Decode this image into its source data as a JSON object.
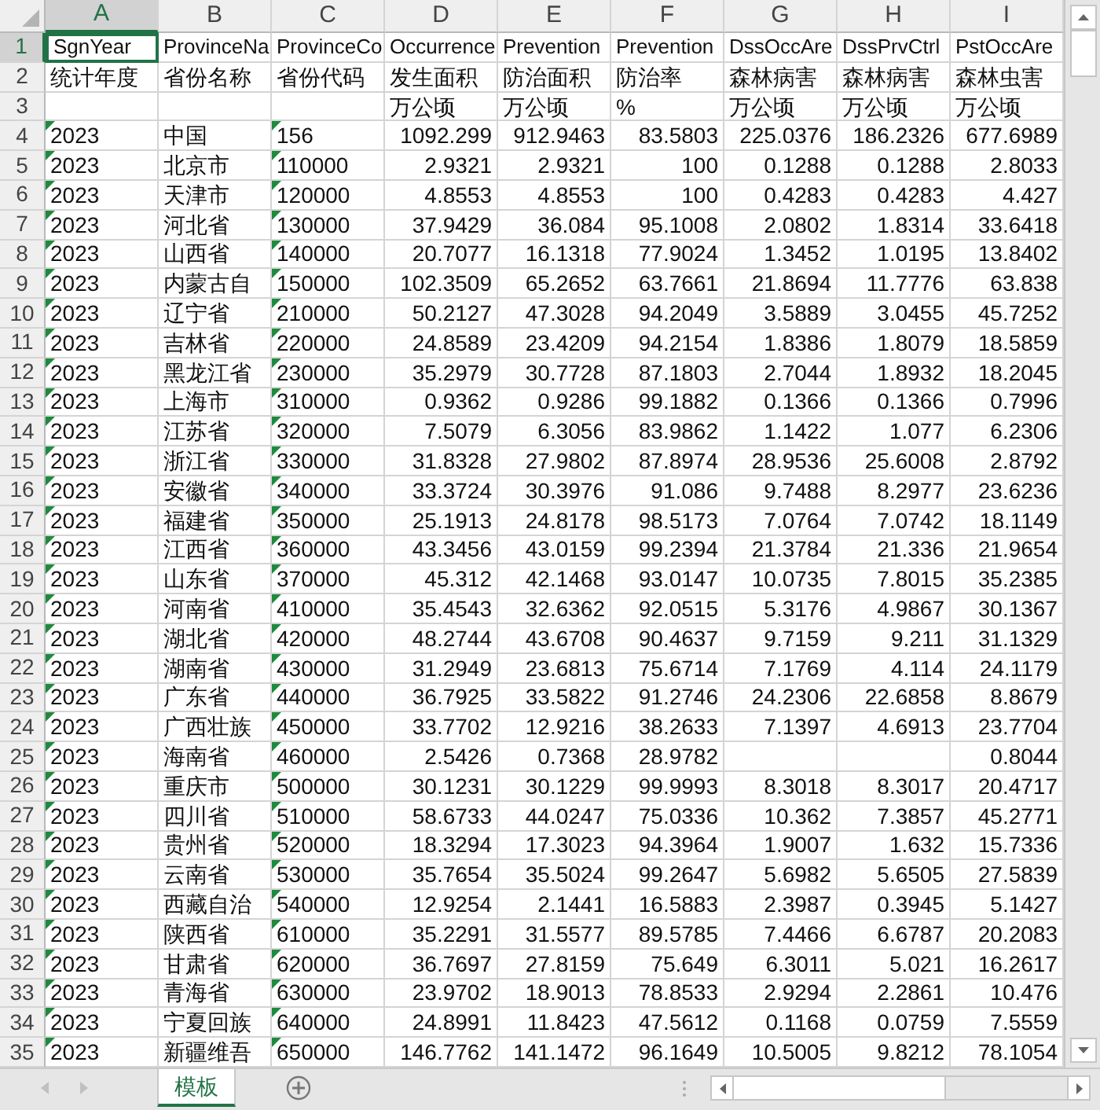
{
  "columns": [
    {
      "letter": "A",
      "selected": true,
      "kind": "text",
      "number_as_text": true
    },
    {
      "letter": "B",
      "selected": false,
      "kind": "text",
      "number_as_text": false
    },
    {
      "letter": "C",
      "selected": false,
      "kind": "text",
      "number_as_text": true
    },
    {
      "letter": "D",
      "selected": false,
      "kind": "number",
      "number_as_text": false
    },
    {
      "letter": "E",
      "selected": false,
      "kind": "number",
      "number_as_text": false
    },
    {
      "letter": "F",
      "selected": false,
      "kind": "number",
      "number_as_text": false
    },
    {
      "letter": "G",
      "selected": false,
      "kind": "number",
      "number_as_text": false
    },
    {
      "letter": "H",
      "selected": false,
      "kind": "number",
      "number_as_text": false
    },
    {
      "letter": "I",
      "selected": false,
      "kind": "number",
      "number_as_text": false
    }
  ],
  "rows": [
    {
      "number": "1",
      "kind": "header",
      "selected": true,
      "cells": [
        "SgnYear",
        "ProvinceNa",
        "ProvinceCo",
        "Occurrence",
        "Prevention",
        "Prevention",
        "DssOccAre",
        "DssPrvCtrl",
        "PstOccAre"
      ]
    },
    {
      "number": "2",
      "kind": "header",
      "selected": false,
      "cells": [
        "统计年度",
        "省份名称",
        "省份代码",
        "发生面积",
        "防治面积",
        "防治率",
        "森林病害",
        "森林病害",
        "森林虫害"
      ]
    },
    {
      "number": "3",
      "kind": "header",
      "selected": false,
      "cells": [
        null,
        null,
        null,
        "万公顷",
        "万公顷",
        "%",
        "万公顷",
        "万公顷",
        "万公顷"
      ]
    },
    {
      "number": "4",
      "kind": "data",
      "selected": false,
      "cells": [
        "2023",
        "中国",
        "156",
        "1092.299",
        "912.9463",
        "83.5803",
        "225.0376",
        "186.2326",
        "677.6989"
      ]
    },
    {
      "number": "5",
      "kind": "data",
      "selected": false,
      "cells": [
        "2023",
        "北京市",
        "110000",
        "2.9321",
        "2.9321",
        "100",
        "0.1288",
        "0.1288",
        "2.8033"
      ]
    },
    {
      "number": "6",
      "kind": "data",
      "selected": false,
      "cells": [
        "2023",
        "天津市",
        "120000",
        "4.8553",
        "4.8553",
        "100",
        "0.4283",
        "0.4283",
        "4.427"
      ]
    },
    {
      "number": "7",
      "kind": "data",
      "selected": false,
      "cells": [
        "2023",
        "河北省",
        "130000",
        "37.9429",
        "36.084",
        "95.1008",
        "2.0802",
        "1.8314",
        "33.6418"
      ]
    },
    {
      "number": "8",
      "kind": "data",
      "selected": false,
      "cells": [
        "2023",
        "山西省",
        "140000",
        "20.7077",
        "16.1318",
        "77.9024",
        "1.3452",
        "1.0195",
        "13.8402"
      ]
    },
    {
      "number": "9",
      "kind": "data",
      "selected": false,
      "cells": [
        "2023",
        "内蒙古自",
        "150000",
        "102.3509",
        "65.2652",
        "63.7661",
        "21.8694",
        "11.7776",
        "63.838"
      ]
    },
    {
      "number": "10",
      "kind": "data",
      "selected": false,
      "cells": [
        "2023",
        "辽宁省",
        "210000",
        "50.2127",
        "47.3028",
        "94.2049",
        "3.5889",
        "3.0455",
        "45.7252"
      ]
    },
    {
      "number": "11",
      "kind": "data",
      "selected": false,
      "cells": [
        "2023",
        "吉林省",
        "220000",
        "24.8589",
        "23.4209",
        "94.2154",
        "1.8386",
        "1.8079",
        "18.5859"
      ]
    },
    {
      "number": "12",
      "kind": "data",
      "selected": false,
      "cells": [
        "2023",
        "黑龙江省",
        "230000",
        "35.2979",
        "30.7728",
        "87.1803",
        "2.7044",
        "1.8932",
        "18.2045"
      ]
    },
    {
      "number": "13",
      "kind": "data",
      "selected": false,
      "cells": [
        "2023",
        "上海市",
        "310000",
        "0.9362",
        "0.9286",
        "99.1882",
        "0.1366",
        "0.1366",
        "0.7996"
      ]
    },
    {
      "number": "14",
      "kind": "data",
      "selected": false,
      "cells": [
        "2023",
        "江苏省",
        "320000",
        "7.5079",
        "6.3056",
        "83.9862",
        "1.1422",
        "1.077",
        "6.2306"
      ]
    },
    {
      "number": "15",
      "kind": "data",
      "selected": false,
      "cells": [
        "2023",
        "浙江省",
        "330000",
        "31.8328",
        "27.9802",
        "87.8974",
        "28.9536",
        "25.6008",
        "2.8792"
      ]
    },
    {
      "number": "16",
      "kind": "data",
      "selected": false,
      "cells": [
        "2023",
        "安徽省",
        "340000",
        "33.3724",
        "30.3976",
        "91.086",
        "9.7488",
        "8.2977",
        "23.6236"
      ]
    },
    {
      "number": "17",
      "kind": "data",
      "selected": false,
      "cells": [
        "2023",
        "福建省",
        "350000",
        "25.1913",
        "24.8178",
        "98.5173",
        "7.0764",
        "7.0742",
        "18.1149"
      ]
    },
    {
      "number": "18",
      "kind": "data",
      "selected": false,
      "cells": [
        "2023",
        "江西省",
        "360000",
        "43.3456",
        "43.0159",
        "99.2394",
        "21.3784",
        "21.336",
        "21.9654"
      ]
    },
    {
      "number": "19",
      "kind": "data",
      "selected": false,
      "cells": [
        "2023",
        "山东省",
        "370000",
        "45.312",
        "42.1468",
        "93.0147",
        "10.0735",
        "7.8015",
        "35.2385"
      ]
    },
    {
      "number": "20",
      "kind": "data",
      "selected": false,
      "cells": [
        "2023",
        "河南省",
        "410000",
        "35.4543",
        "32.6362",
        "92.0515",
        "5.3176",
        "4.9867",
        "30.1367"
      ]
    },
    {
      "number": "21",
      "kind": "data",
      "selected": false,
      "cells": [
        "2023",
        "湖北省",
        "420000",
        "48.2744",
        "43.6708",
        "90.4637",
        "9.7159",
        "9.211",
        "31.1329"
      ]
    },
    {
      "number": "22",
      "kind": "data",
      "selected": false,
      "cells": [
        "2023",
        "湖南省",
        "430000",
        "31.2949",
        "23.6813",
        "75.6714",
        "7.1769",
        "4.114",
        "24.1179"
      ]
    },
    {
      "number": "23",
      "kind": "data",
      "selected": false,
      "cells": [
        "2023",
        "广东省",
        "440000",
        "36.7925",
        "33.5822",
        "91.2746",
        "24.2306",
        "22.6858",
        "8.8679"
      ]
    },
    {
      "number": "24",
      "kind": "data",
      "selected": false,
      "cells": [
        "2023",
        "广西壮族",
        "450000",
        "33.7702",
        "12.9216",
        "38.2633",
        "7.1397",
        "4.6913",
        "23.7704"
      ]
    },
    {
      "number": "25",
      "kind": "data",
      "selected": false,
      "cells": [
        "2023",
        "海南省",
        "460000",
        "2.5426",
        "0.7368",
        "28.9782",
        null,
        null,
        "0.8044"
      ]
    },
    {
      "number": "26",
      "kind": "data",
      "selected": false,
      "cells": [
        "2023",
        "重庆市",
        "500000",
        "30.1231",
        "30.1229",
        "99.9993",
        "8.3018",
        "8.3017",
        "20.4717"
      ]
    },
    {
      "number": "27",
      "kind": "data",
      "selected": false,
      "cells": [
        "2023",
        "四川省",
        "510000",
        "58.6733",
        "44.0247",
        "75.0336",
        "10.362",
        "7.3857",
        "45.2771"
      ]
    },
    {
      "number": "28",
      "kind": "data",
      "selected": false,
      "cells": [
        "2023",
        "贵州省",
        "520000",
        "18.3294",
        "17.3023",
        "94.3964",
        "1.9007",
        "1.632",
        "15.7336"
      ]
    },
    {
      "number": "29",
      "kind": "data",
      "selected": false,
      "cells": [
        "2023",
        "云南省",
        "530000",
        "35.7654",
        "35.5024",
        "99.2647",
        "5.6982",
        "5.6505",
        "27.5839"
      ]
    },
    {
      "number": "30",
      "kind": "data",
      "selected": false,
      "cells": [
        "2023",
        "西藏自治",
        "540000",
        "12.9254",
        "2.1441",
        "16.5883",
        "2.3987",
        "0.3945",
        "5.1427"
      ]
    },
    {
      "number": "31",
      "kind": "data",
      "selected": false,
      "cells": [
        "2023",
        "陕西省",
        "610000",
        "35.2291",
        "31.5577",
        "89.5785",
        "7.4466",
        "6.6787",
        "20.2083"
      ]
    },
    {
      "number": "32",
      "kind": "data",
      "selected": false,
      "cells": [
        "2023",
        "甘肃省",
        "620000",
        "36.7697",
        "27.8159",
        "75.649",
        "6.3011",
        "5.021",
        "16.2617"
      ]
    },
    {
      "number": "33",
      "kind": "data",
      "selected": false,
      "cells": [
        "2023",
        "青海省",
        "630000",
        "23.9702",
        "18.9013",
        "78.8533",
        "2.9294",
        "2.2861",
        "10.476"
      ]
    },
    {
      "number": "34",
      "kind": "data",
      "selected": false,
      "cells": [
        "2023",
        "宁夏回族",
        "640000",
        "24.8991",
        "11.8423",
        "47.5612",
        "0.1168",
        "0.0759",
        "7.5559"
      ]
    },
    {
      "number": "35",
      "kind": "data",
      "selected": false,
      "cells": [
        "2023",
        "新疆维吾",
        "650000",
        "146.7762",
        "141.1472",
        "96.1649",
        "10.5005",
        "9.8212",
        "78.1054"
      ]
    }
  ],
  "sheet_tabs": [
    {
      "label": "模板",
      "selected": true
    }
  ]
}
